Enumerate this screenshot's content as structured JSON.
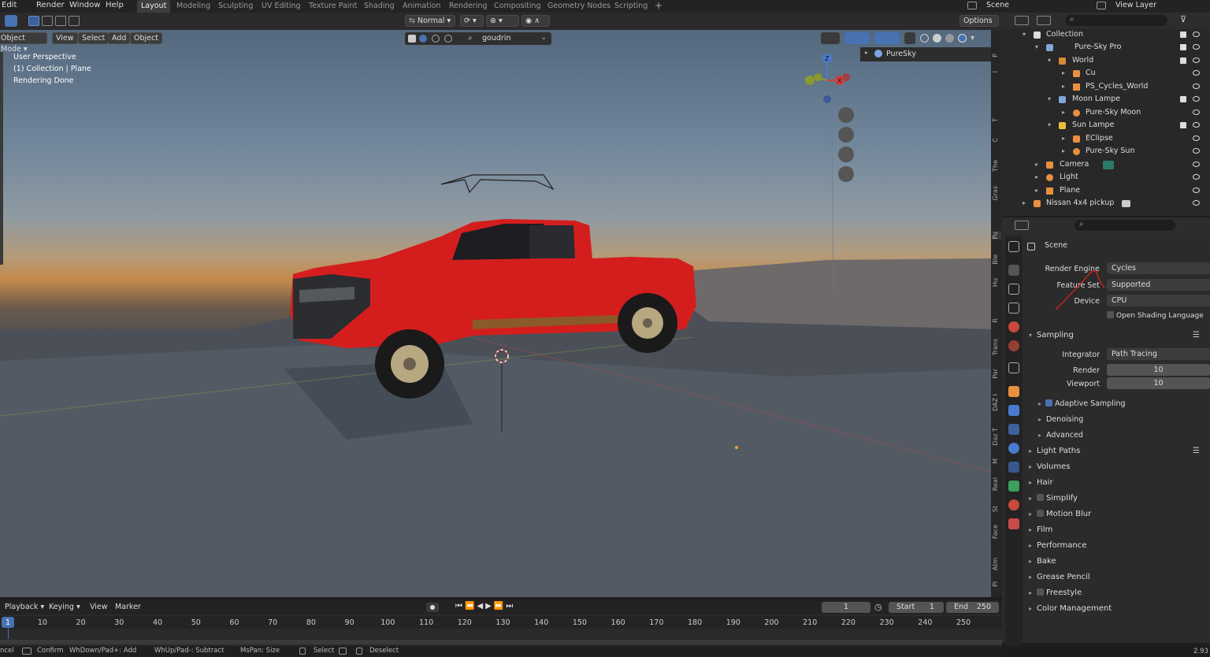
{
  "top_menu": {
    "items": [
      "Edit",
      "Render",
      "Window",
      "Help"
    ]
  },
  "workspaces": [
    "Layout",
    "Modeling",
    "Sculpting",
    "UV Editing",
    "Texture Paint",
    "Shading",
    "Animation",
    "Rendering",
    "Compositing",
    "Geometry Nodes",
    "Scripting"
  ],
  "top_right": {
    "scene": "Scene",
    "view_layer": "View Layer"
  },
  "header2": {
    "transform": "Normal",
    "options": "Options",
    "material": "goudrin"
  },
  "viewport_header": {
    "mode": "Object Mode",
    "view": "View",
    "select": "Select",
    "add": "Add",
    "object": "Object"
  },
  "viewport_info": {
    "line1": "User Perspective",
    "line2": "(1) Collection | Plane",
    "line3": "Rendering Done"
  },
  "npanel_header": "PureSky",
  "side_tabs": [
    "P",
    "I",
    "T",
    "C",
    "The",
    "Gras",
    "Pu",
    "Ble",
    "Hu",
    "R",
    "Trans",
    "Par",
    "DAZ I",
    "Daz T",
    "M",
    "Real",
    "St",
    "Face",
    "Atm",
    "Pl"
  ],
  "outliner": {
    "rows": [
      {
        "label": "Collection",
        "indent": 0
      },
      {
        "label": "Pure-Sky Pro",
        "indent": 1
      },
      {
        "label": "World",
        "indent": 2
      },
      {
        "label": "Cu",
        "indent": 3
      },
      {
        "label": "PS_Cycles_World",
        "indent": 3
      },
      {
        "label": "Moon Lampe",
        "indent": 2
      },
      {
        "label": "Pure-Sky Moon",
        "indent": 3
      },
      {
        "label": "Sun Lampe",
        "indent": 2
      },
      {
        "label": "EClipse",
        "indent": 3
      },
      {
        "label": "Pure-Sky Sun",
        "indent": 3
      },
      {
        "label": "Camera",
        "indent": 1
      },
      {
        "label": "Light",
        "indent": 1
      },
      {
        "label": "Plane",
        "indent": 1
      },
      {
        "label": "Nissan 4x4 pickup",
        "indent": 0
      }
    ]
  },
  "properties": {
    "context": "Scene",
    "render_engine_label": "Render Engine",
    "render_engine": "Cycles",
    "feature_set_label": "Feature Set",
    "feature_set": "Supported",
    "device_label": "Device",
    "device": "CPU",
    "osl": "Open Shading Language",
    "sampling": "Sampling",
    "integrator_label": "Integrator",
    "integrator": "Path Tracing",
    "render_label": "Render",
    "render_samples": "10",
    "viewport_label": "Viewport",
    "viewport_samples": "10",
    "adaptive": "Adaptive Sampling",
    "denoising": "Denoising",
    "advanced": "Advanced",
    "sections": [
      "Light Paths",
      "Volumes",
      "Hair",
      "Simplify",
      "Motion Blur",
      "Film",
      "Performance",
      "Bake",
      "Grease Pencil",
      "Freestyle",
      "Color Management"
    ]
  },
  "timeline": {
    "playback": "Playback",
    "keying": "Keying",
    "view": "View",
    "marker": "Marker",
    "current_frame": "1",
    "start_label": "Start",
    "start": "1",
    "end_label": "End",
    "end": "250",
    "ticks": [
      "1",
      "10",
      "20",
      "30",
      "40",
      "50",
      "60",
      "70",
      "80",
      "90",
      "100",
      "110",
      "120",
      "130",
      "140",
      "150",
      "160",
      "170",
      "180",
      "190",
      "200",
      "210",
      "220",
      "230",
      "240",
      "250"
    ]
  },
  "statusbar": {
    "cancel": "ncel",
    "confirm": "Confirm",
    "whdown": "WhDown/Pad+: Add",
    "whup": "WhUp/Pad-: Subtract",
    "mspan": "MsPan: Size",
    "select": "Select",
    "deselect": "Deselect",
    "version": "2.93"
  }
}
